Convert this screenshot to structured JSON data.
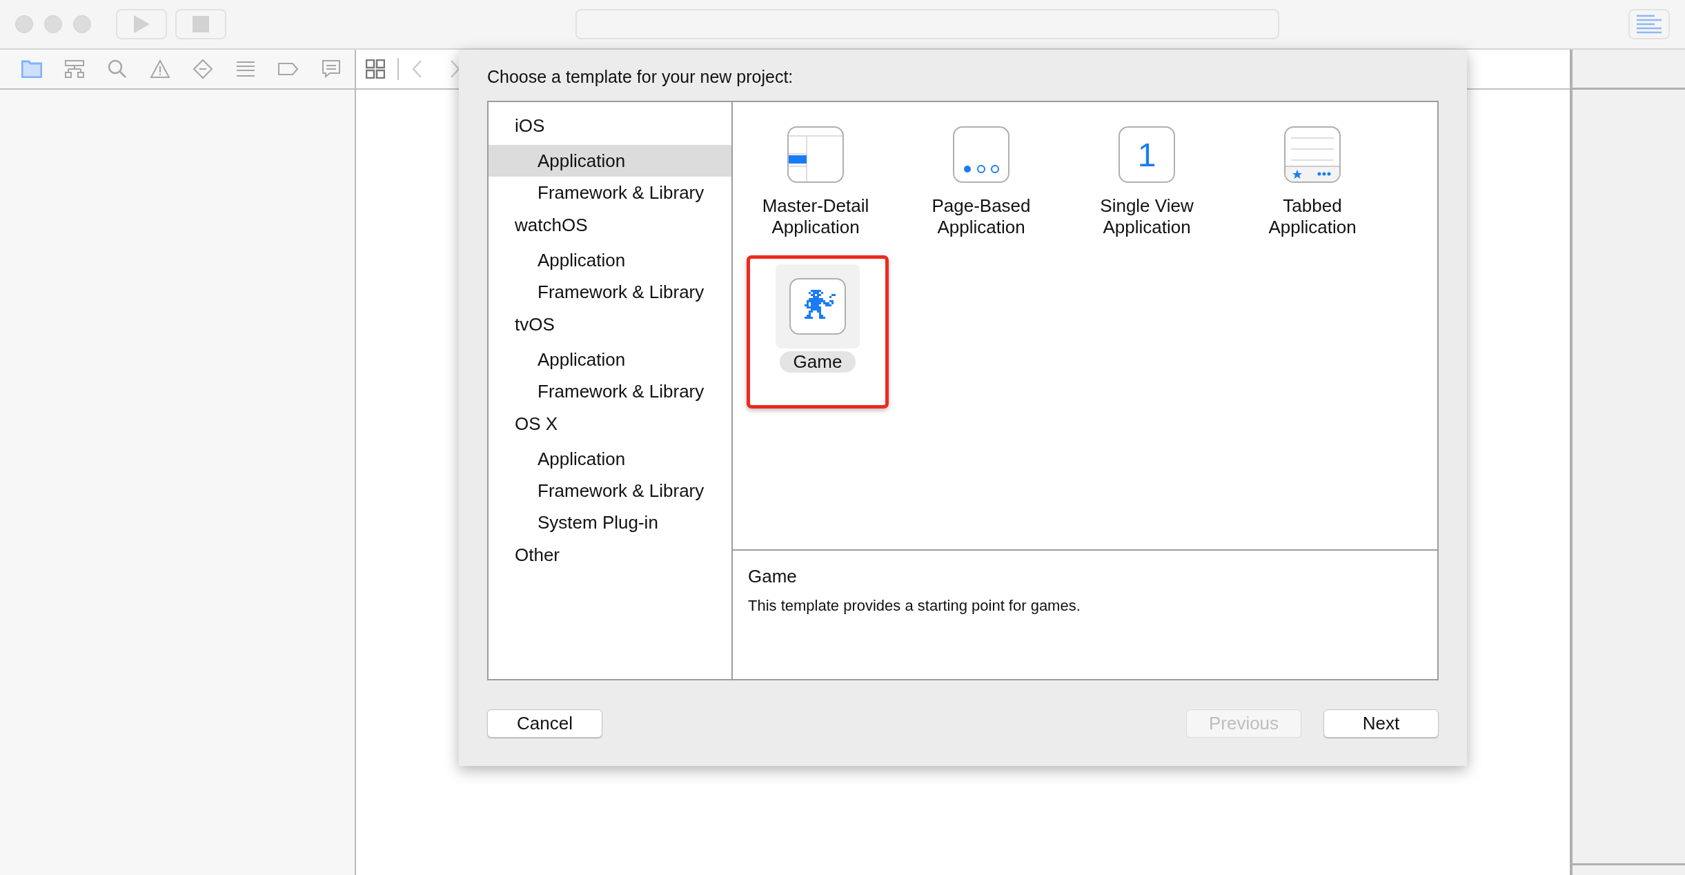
{
  "toolbar": {
    "run_disabled": true,
    "stop_disabled": true
  },
  "navigator_tabs": [
    {
      "kind": "folder",
      "selected": true
    },
    {
      "kind": "hierarchy",
      "selected": false
    },
    {
      "kind": "search",
      "selected": false
    },
    {
      "kind": "warning",
      "selected": false
    },
    {
      "kind": "test",
      "selected": false
    },
    {
      "kind": "debug",
      "selected": false
    },
    {
      "kind": "breakpoint",
      "selected": false
    },
    {
      "kind": "report",
      "selected": false
    }
  ],
  "dialog": {
    "title": "Choose a template for your new project:",
    "categories": [
      {
        "label": "iOS",
        "children": [
          {
            "label": "Application",
            "selected": true
          },
          {
            "label": "Framework & Library",
            "selected": false
          }
        ]
      },
      {
        "label": "watchOS",
        "children": [
          {
            "label": "Application",
            "selected": false
          },
          {
            "label": "Framework & Library",
            "selected": false
          }
        ]
      },
      {
        "label": "tvOS",
        "children": [
          {
            "label": "Application",
            "selected": false
          },
          {
            "label": "Framework & Library",
            "selected": false
          }
        ]
      },
      {
        "label": "OS X",
        "children": [
          {
            "label": "Application",
            "selected": false
          },
          {
            "label": "Framework & Library",
            "selected": false
          },
          {
            "label": "System Plug-in",
            "selected": false
          }
        ]
      },
      {
        "label": "Other"
      }
    ],
    "templates": [
      {
        "kind": "master-detail",
        "label": "Master-Detail Application",
        "selected": false
      },
      {
        "kind": "page-based",
        "label": "Page-Based Application",
        "selected": false
      },
      {
        "kind": "single-view",
        "label": "Single View Application",
        "icon_text": "1",
        "selected": false
      },
      {
        "kind": "tabbed",
        "label": "Tabbed Application",
        "selected": false
      },
      {
        "kind": "game",
        "label": "Game",
        "selected": true
      }
    ],
    "description": {
      "title": "Game",
      "text": "This template provides a starting point for games."
    },
    "buttons_left": [
      {
        "label": "Cancel",
        "disabled": false
      }
    ],
    "buttons_right": [
      {
        "label": "Previous",
        "disabled": true
      },
      {
        "label": "Next",
        "disabled": false
      }
    ]
  }
}
